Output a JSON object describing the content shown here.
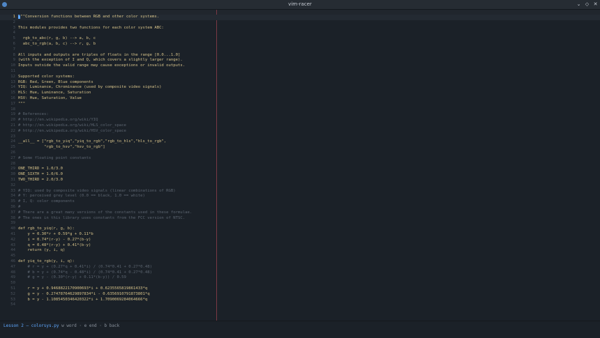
{
  "window": {
    "title": "vim-racer"
  },
  "window_buttons": {
    "minimize": "⌄",
    "maximize": "◇",
    "close": "✕"
  },
  "status": {
    "lesson": "Lesson 2 — colorsys.py",
    "hint": " w word · e end · b back"
  },
  "lines": [
    {
      "n": "1",
      "t": "\"\"\"Conversion functions between RGB and other color systems."
    },
    {
      "n": "2",
      "t": ""
    },
    {
      "n": "3",
      "t": "This modules provides two functions for each color system ABC:"
    },
    {
      "n": "4",
      "t": ""
    },
    {
      "n": "5",
      "t": "  rgb_to_abc(r, g, b) --> a, b, c"
    },
    {
      "n": "6",
      "t": "  abc_to_rgb(a, b, c) --> r, g, b"
    },
    {
      "n": "7",
      "t": ""
    },
    {
      "n": "8",
      "t": "All inputs and outputs are triples of floats in the range [0.0...1.0]"
    },
    {
      "n": "9",
      "t": "(with the exception of I and Q, which covers a slightly larger range)."
    },
    {
      "n": "10",
      "t": "Inputs outside the valid range may cause exceptions or invalid outputs."
    },
    {
      "n": "11",
      "t": ""
    },
    {
      "n": "12",
      "t": "Supported color systems:"
    },
    {
      "n": "13",
      "t": "RGB: Red, Green, Blue components"
    },
    {
      "n": "14",
      "t": "YIQ: Luminance, Chrominance (used by composite video signals)"
    },
    {
      "n": "15",
      "t": "HLS: Hue, Luminance, Saturation"
    },
    {
      "n": "16",
      "t": "HSV: Hue, Saturation, Value"
    },
    {
      "n": "17",
      "t": "\"\"\""
    },
    {
      "n": "18",
      "t": ""
    },
    {
      "n": "19",
      "t": "# References:"
    },
    {
      "n": "20",
      "t": "# http://en.wikipedia.org/wiki/YIQ"
    },
    {
      "n": "21",
      "t": "# http://en.wikipedia.org/wiki/HLS_color_space"
    },
    {
      "n": "22",
      "t": "# http://en.wikipedia.org/wiki/HSV_color_space"
    },
    {
      "n": "23",
      "t": ""
    },
    {
      "n": "24",
      "t": "__all__ = [\"rgb_to_yiq\",\"yiq_to_rgb\",\"rgb_to_hls\",\"hls_to_rgb\","
    },
    {
      "n": "25",
      "t": "           \"rgb_to_hsv\",\"hsv_to_rgb\"]"
    },
    {
      "n": "26",
      "t": ""
    },
    {
      "n": "27",
      "t": "# Some floating point constants"
    },
    {
      "n": "28",
      "t": ""
    },
    {
      "n": "29",
      "t": "ONE_THIRD = 1.0/3.0"
    },
    {
      "n": "30",
      "t": "ONE_SIXTH = 1.0/6.0"
    },
    {
      "n": "31",
      "t": "TWO_THIRD = 2.0/3.0"
    },
    {
      "n": "32",
      "t": ""
    },
    {
      "n": "33",
      "t": "# YIQ: used by composite video signals (linear combinations of RGB)"
    },
    {
      "n": "34",
      "t": "# Y: perceived grey level (0.0 == black, 1.0 == white)"
    },
    {
      "n": "35",
      "t": "# I, Q: color components"
    },
    {
      "n": "36",
      "t": "#"
    },
    {
      "n": "37",
      "t": "# There are a great many versions of the constants used in these formulae."
    },
    {
      "n": "38",
      "t": "# The ones in this library uses constants from the FCC version of NTSC."
    },
    {
      "n": "39",
      "t": ""
    },
    {
      "n": "40",
      "t": "def rgb_to_yiq(r, g, b):"
    },
    {
      "n": "41",
      "t": "    y = 0.30*r + 0.59*g + 0.11*b"
    },
    {
      "n": "42",
      "t": "    i = 0.74*(r-y) - 0.27*(b-y)"
    },
    {
      "n": "43",
      "t": "    q = 0.48*(r-y) + 0.41*(b-y)"
    },
    {
      "n": "44",
      "t": "    return (y, i, q)"
    },
    {
      "n": "45",
      "t": ""
    },
    {
      "n": "46",
      "t": "def yiq_to_rgb(y, i, q):"
    },
    {
      "n": "47",
      "t": "    # r = y + (0.27*q + 0.41*i) / (0.74*0.41 + 0.27*0.48)"
    },
    {
      "n": "48",
      "t": "    # b = y + (0.74*q - 0.48*i) / (0.74*0.41 + 0.27*0.48)"
    },
    {
      "n": "49",
      "t": "    # g = y - (0.30*(r-y) + 0.11*(b-y)) / 0.59"
    },
    {
      "n": "50",
      "t": ""
    },
    {
      "n": "51",
      "t": "    r = y + 0.9468822170900693*i + 0.6235565819861433*q"
    },
    {
      "n": "52",
      "t": "    g = y - 0.27478764629897834*i - 0.6356910791873801*q"
    },
    {
      "n": "53",
      "t": "    b = y - 1.1085450346420322*i + 1.7090069284064666*q"
    },
    {
      "n": "54",
      "t": ""
    }
  ]
}
